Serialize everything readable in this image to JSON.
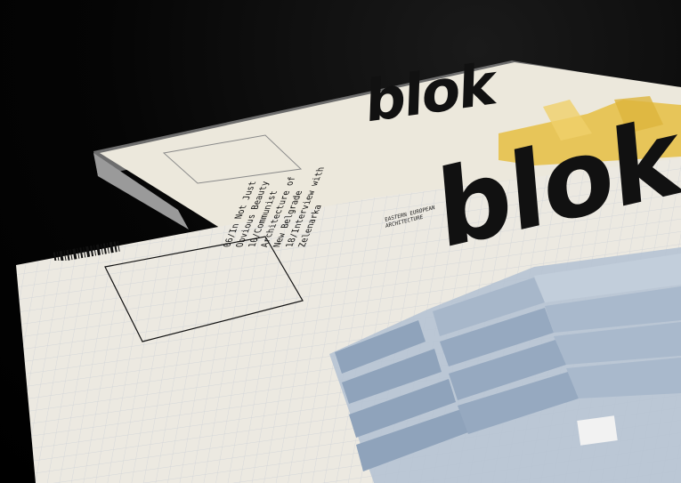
{
  "back_magazine": {
    "logo": "blok"
  },
  "front_magazine": {
    "logo": "blok",
    "tagline": "EASTERN EUROPEAN ARCHITECTURE",
    "contents": [
      "06/In Not Just",
      "Obvious Beauty",
      "10/Communist",
      "Architecture of",
      "New Belgrade",
      "18/Interview with",
      "Zelenarka"
    ]
  },
  "colors": {
    "paper": "#ece8df",
    "grid": "#c9cfd6",
    "yellow": "#e8c24a",
    "building_blue": "#9fb1c6",
    "ink": "#111111"
  }
}
